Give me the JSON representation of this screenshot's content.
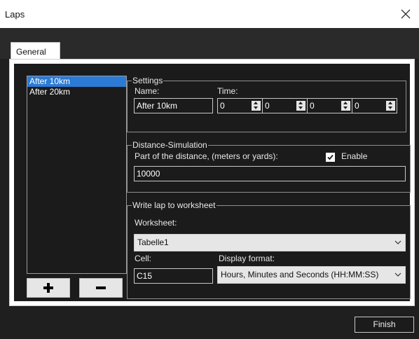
{
  "window": {
    "title": "Laps"
  },
  "tabs": [
    {
      "label": "General"
    }
  ],
  "laps": {
    "items": [
      "After 10km",
      "After 20km"
    ],
    "selected_index": 0
  },
  "buttons": {
    "add": "+",
    "remove": "−",
    "finish": "Finish"
  },
  "settings": {
    "legend": "Settings",
    "name_label": "Name:",
    "time_label": "Time:",
    "name_value": "After 10km",
    "time_values": [
      "0",
      "0",
      "0",
      "0"
    ]
  },
  "distance": {
    "legend": "Distance-Simulation",
    "part_label": "Part of the distance, (meters or yards):",
    "enable_label": "Enable",
    "enable_checked": true,
    "value": "10000"
  },
  "worksheet": {
    "legend": "Write lap to worksheet",
    "worksheet_label": "Worksheet:",
    "worksheet_value": "Tabelle1",
    "cell_label": "Cell:",
    "cell_value": "C15",
    "format_label": "Display format:",
    "format_value": "Hours, Minutes and Seconds (HH:MM:SS)"
  },
  "colors": {
    "selection": "#2b7bd6",
    "background": "#1b1b1b"
  }
}
